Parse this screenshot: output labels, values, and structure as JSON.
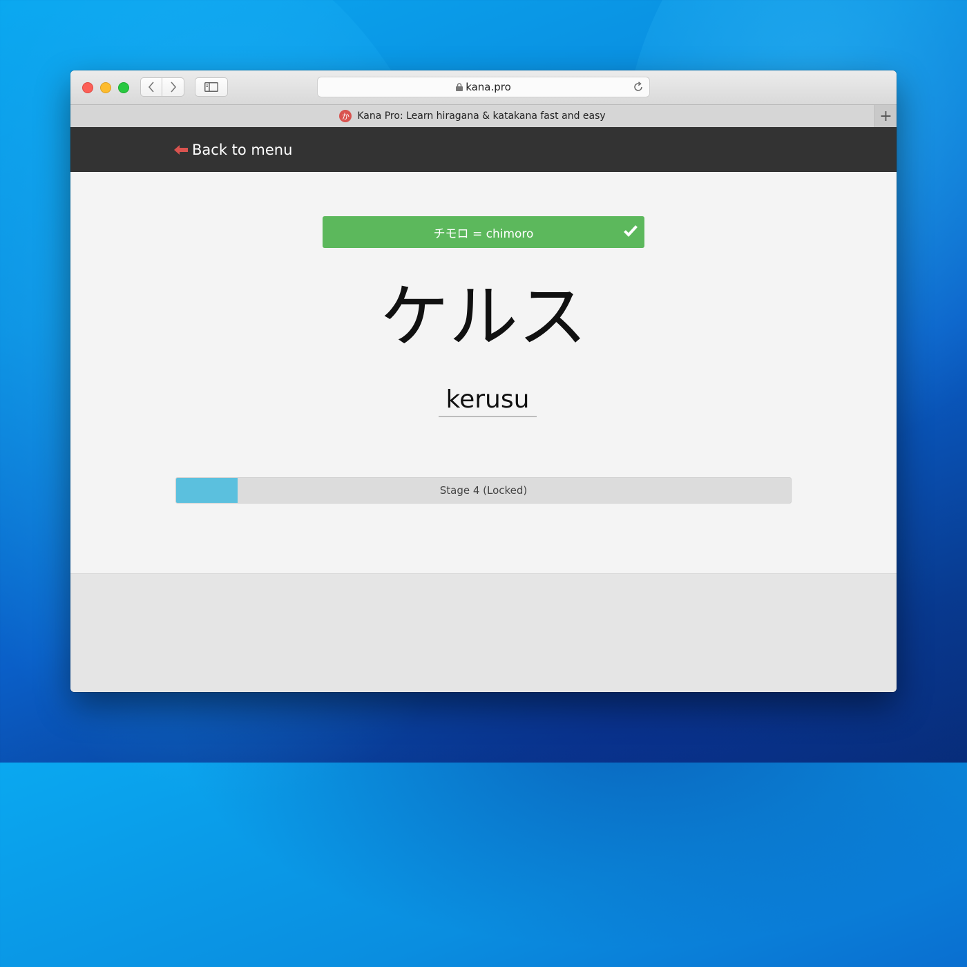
{
  "browser": {
    "url": "kana.pro",
    "tab_title": "Kana Pro: Learn hiragana & katakana fast and easy",
    "favicon_glyph": "か",
    "new_tab_glyph": "+"
  },
  "header": {
    "back_label": "Back to menu"
  },
  "quiz": {
    "feedback_text": "チモロ = chimoro",
    "kana_prompt": "ケルス",
    "answer_value": "kerusu"
  },
  "progress": {
    "label": "Stage 4 (Locked)",
    "fraction": 0.1
  },
  "colors": {
    "header_bg": "#333333",
    "correct_green": "#5cb85c",
    "progress_fill": "#5bc0de",
    "back_arrow": "#d9534f"
  },
  "icons": [
    "lock-icon",
    "reload-icon",
    "chevron-left-icon",
    "chevron-right-icon",
    "sidebar-icon",
    "check-icon",
    "arrow-left-icon"
  ]
}
